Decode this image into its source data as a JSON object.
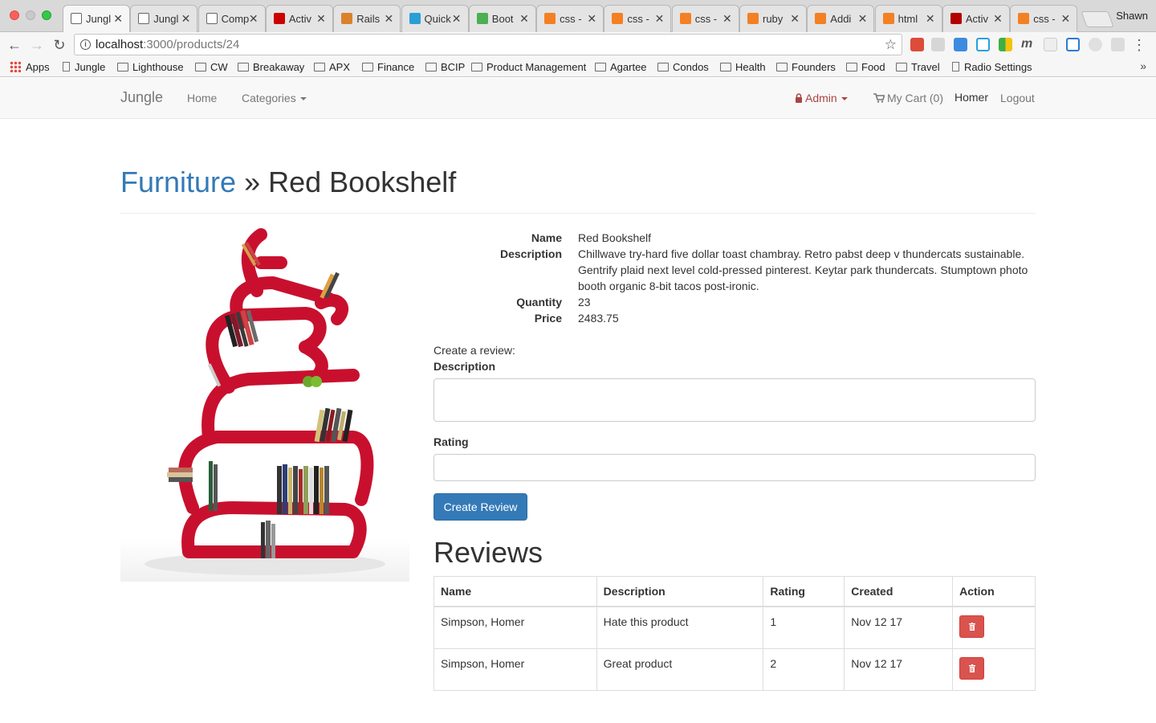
{
  "browser": {
    "tabs": [
      {
        "title": "Jungl",
        "icon": "page-icon",
        "active": true
      },
      {
        "title": "Jungl",
        "icon": "page-icon"
      },
      {
        "title": "Comp",
        "icon": "globe-icon"
      },
      {
        "title": "Activ",
        "icon": "rails-icon"
      },
      {
        "title": "Rails",
        "icon": "railscasts-icon"
      },
      {
        "title": "Quick",
        "icon": "bootstrap-icon"
      },
      {
        "title": "Boot",
        "icon": "w3-icon"
      },
      {
        "title": "css -",
        "icon": "stackoverflow-icon"
      },
      {
        "title": "css -",
        "icon": "stackoverflow-icon"
      },
      {
        "title": "css -",
        "icon": "stackoverflow-icon"
      },
      {
        "title": "ruby",
        "icon": "stackoverflow-icon"
      },
      {
        "title": "Addi",
        "icon": "stackoverflow-icon"
      },
      {
        "title": "html",
        "icon": "stackoverflow-icon"
      },
      {
        "title": "Activ",
        "icon": "ruby-icon"
      },
      {
        "title": "css -",
        "icon": "stackoverflow-icon"
      }
    ],
    "profile_name": "Shawn",
    "url_host": "localhost",
    "url_rest": ":3000/products/24",
    "bookmarks": [
      "Apps",
      "Jungle",
      "Lighthouse",
      "CW",
      "Breakaway",
      "APX",
      "Finance",
      "BCIP",
      "Product Management",
      "Agartee",
      "Condos",
      "Health",
      "Founders",
      "Food",
      "Travel",
      "Radio Settings"
    ],
    "bookmark_more": "»"
  },
  "navbar": {
    "brand": "Jungle",
    "home": "Home",
    "categories": "Categories",
    "admin": "Admin",
    "cart": "My Cart (0)",
    "user": "Homer",
    "logout": "Logout"
  },
  "product": {
    "category": "Furniture",
    "separator": "»",
    "name": "Red Bookshelf",
    "fields": [
      {
        "label": "Name",
        "value": "Red Bookshelf"
      },
      {
        "label": "Description",
        "value": "Chillwave try-hard five dollar toast chambray. Retro pabst deep v thundercats sustainable. Gentrify plaid next level cold-pressed pinterest. Keytar park thundercats. Stumptown photo booth organic 8-bit tacos post-ironic."
      },
      {
        "label": "Quantity",
        "value": "23"
      },
      {
        "label": "Price",
        "value": "2483.75"
      }
    ]
  },
  "review_form": {
    "heading": "Create a review:",
    "description_label": "Description",
    "description_value": "",
    "rating_label": "Rating",
    "rating_value": "",
    "submit": "Create Review"
  },
  "reviews": {
    "heading": "Reviews",
    "columns": [
      "Name",
      "Description",
      "Rating",
      "Created",
      "Action"
    ],
    "rows": [
      {
        "name": "Simpson, Homer",
        "description": "Hate this product",
        "rating": "1",
        "created": "Nov 12 17"
      },
      {
        "name": "Simpson, Homer",
        "description": "Great product",
        "rating": "2",
        "created": "Nov 12 17"
      }
    ]
  },
  "colors": {
    "link": "#337ab7",
    "primary": "#337ab7",
    "danger": "#d9534f",
    "admin": "#a94442",
    "bookshelf_red": "#c8102e"
  }
}
